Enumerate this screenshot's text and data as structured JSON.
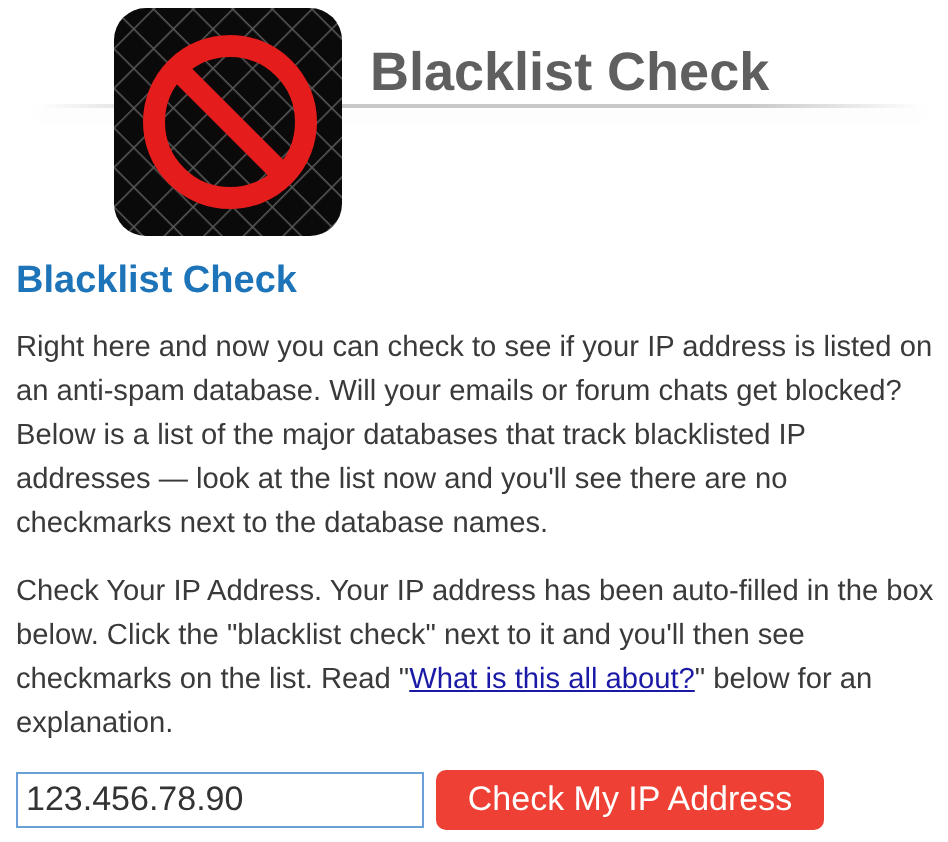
{
  "header": {
    "title": "Blacklist Check"
  },
  "heading": "Blacklist Check",
  "paragraphs": [
    {
      "before": "Right here and now you can check to see if your IP address is listed on an anti-spam database. Will your emails or forum chats get blocked? Below is a list of the major databases that track blacklisted IP addresses — look at the list now and you'll see there are no checkmarks next to the database names."
    },
    {
      "before": "Check Your IP Address. Your IP address has been auto-filled in the box below. Click the \"blacklist check\" next to it and you'll then see checkmarks on the list. Read \"",
      "link": "What is this all about?",
      "after": "\" below for an explanation."
    }
  ],
  "form": {
    "value": "123.456.78.90",
    "button": "Check My IP Address"
  }
}
